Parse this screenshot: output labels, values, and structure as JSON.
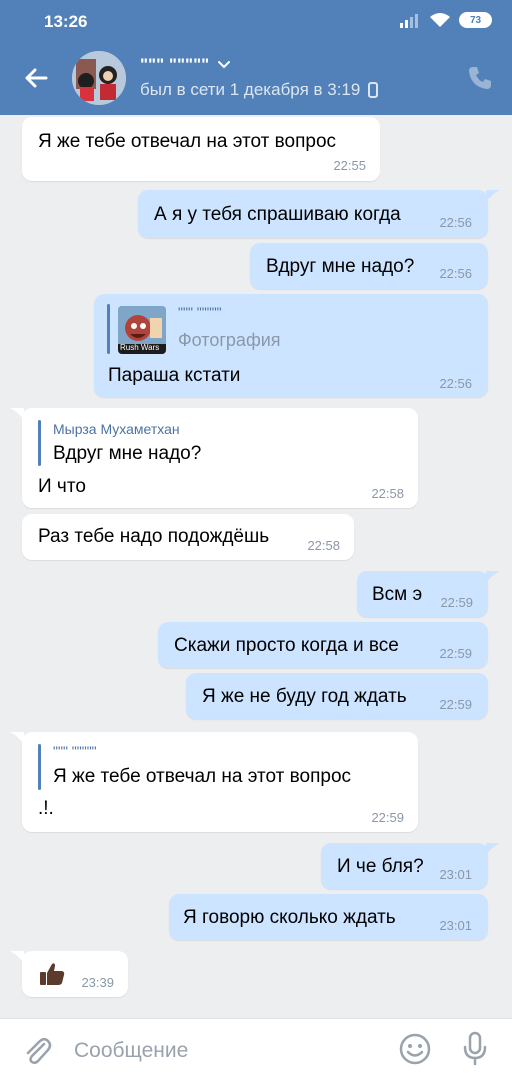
{
  "status_bar": {
    "time": "13:26",
    "battery": "73"
  },
  "header": {
    "name": "\"\"\" \"\"\"\"\"",
    "last_seen": "был в сети 1 декабря в 3:19"
  },
  "messages": [
    {
      "text": "Я же тебе отвечал на этот вопрос",
      "time": "22:55"
    },
    {
      "text": "А я у тебя спрашиваю когда",
      "time": "22:56"
    },
    {
      "text": "Вдруг мне надо?",
      "time": "22:56"
    },
    {
      "quote_name": "\"\"\" \"\"\"\"\"",
      "quote_text": "Фотография",
      "thumb_label": "Rush Wars",
      "text": "Параша кстати",
      "time": "22:56"
    },
    {
      "quote_name": "Мырза Мухаметхан",
      "quote_text": "Вдруг мне надо?",
      "text": "И что",
      "time": "22:58"
    },
    {
      "text": "Раз тебе надо подождёшь",
      "time": "22:58"
    },
    {
      "text": "Всм э",
      "time": "22:59"
    },
    {
      "text": "Скажи просто когда и все",
      "time": "22:59"
    },
    {
      "text": "Я же не буду год ждать",
      "time": "22:59"
    },
    {
      "quote_name": "\"\"\" \"\"\"\"\"",
      "quote_text": "Я же тебе отвечал на этот вопрос",
      "text": ".!.",
      "time": "22:59"
    },
    {
      "text": "И че бля?",
      "time": "23:01"
    },
    {
      "text": "Я говорю сколько ждать",
      "time": "23:01"
    },
    {
      "emoji": "thumbs-up",
      "time": "23:39"
    }
  ],
  "composer": {
    "placeholder": "Сообщение"
  },
  "colors": {
    "header": "#5181b8",
    "outgoing": "#cce4ff",
    "incoming": "#ffffff",
    "background": "#edeef0"
  }
}
